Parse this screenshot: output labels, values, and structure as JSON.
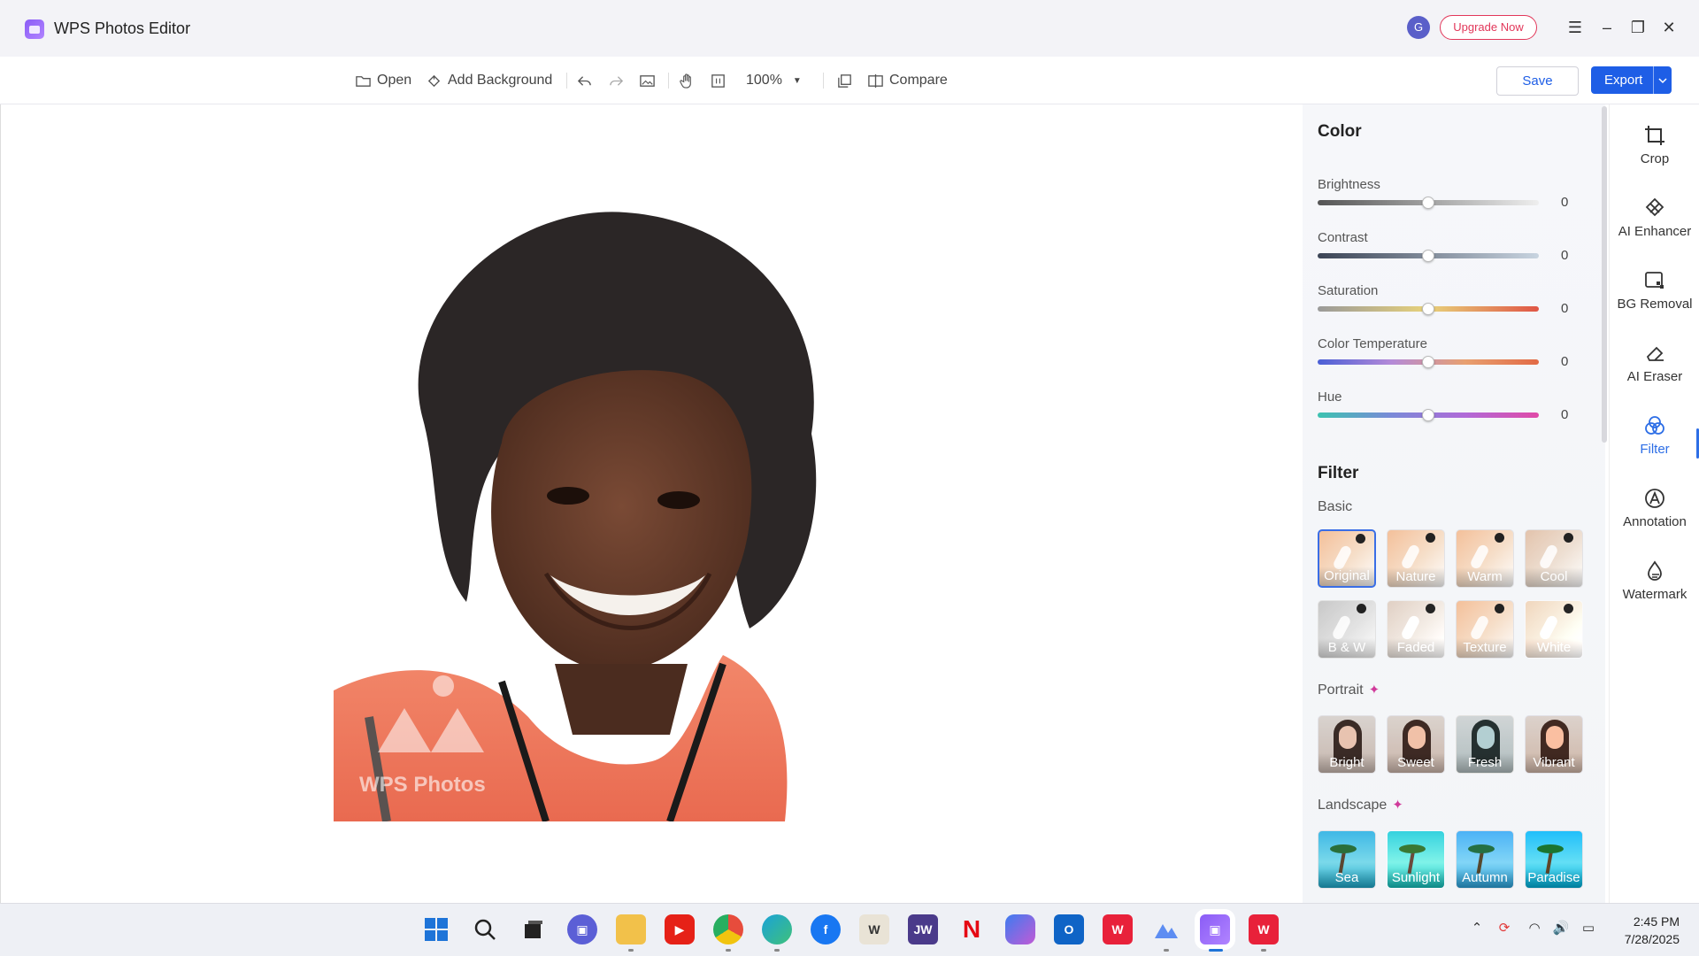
{
  "app": {
    "title": "WPS Photos Editor",
    "avatar_letter": "G",
    "upgrade_label": "Upgrade Now"
  },
  "toolbar": {
    "open_label": "Open",
    "add_background_label": "Add Background",
    "zoom_value": "100%",
    "compare_label": "Compare",
    "save_label": "Save",
    "export_label": "Export"
  },
  "canvas": {
    "watermark_text": "WPS Photos"
  },
  "color": {
    "title": "Color",
    "sliders": [
      {
        "label": "Brightness",
        "value": "0"
      },
      {
        "label": "Contrast",
        "value": "0"
      },
      {
        "label": "Saturation",
        "value": "0"
      },
      {
        "label": "Color Temperature",
        "value": "0"
      },
      {
        "label": "Hue",
        "value": "0"
      }
    ]
  },
  "filter": {
    "title": "Filter",
    "basic_label": "Basic",
    "basic": [
      "Original",
      "Nature",
      "Warm",
      "Cool",
      "B & W",
      "Faded",
      "Texture",
      "White"
    ],
    "selected": "Original",
    "portrait_label": "Portrait",
    "portrait": [
      "Bright",
      "Sweet",
      "Fresh",
      "Vibrant"
    ],
    "landscape_label": "Landscape",
    "landscape": [
      "Sea",
      "Sunlight",
      "Autumn",
      "Paradise"
    ]
  },
  "rail": [
    {
      "label": "Crop",
      "icon": "crop-icon"
    },
    {
      "label": "AI Enhancer",
      "icon": "ai-enhancer-icon"
    },
    {
      "label": "BG Removal",
      "icon": "bg-removal-icon"
    },
    {
      "label": "AI Eraser",
      "icon": "eraser-icon"
    },
    {
      "label": "Filter",
      "icon": "filter-icon",
      "active": true
    },
    {
      "label": "Annotation",
      "icon": "annotation-icon"
    },
    {
      "label": "Watermark",
      "icon": "watermark-icon"
    }
  ],
  "taskbar": {
    "time": "2:45 PM",
    "date": "7/28/2025"
  },
  "colors": {
    "accent": "#1e5ee6",
    "upgrade": "#e2375a",
    "active_tab": "#2d6ee6"
  }
}
